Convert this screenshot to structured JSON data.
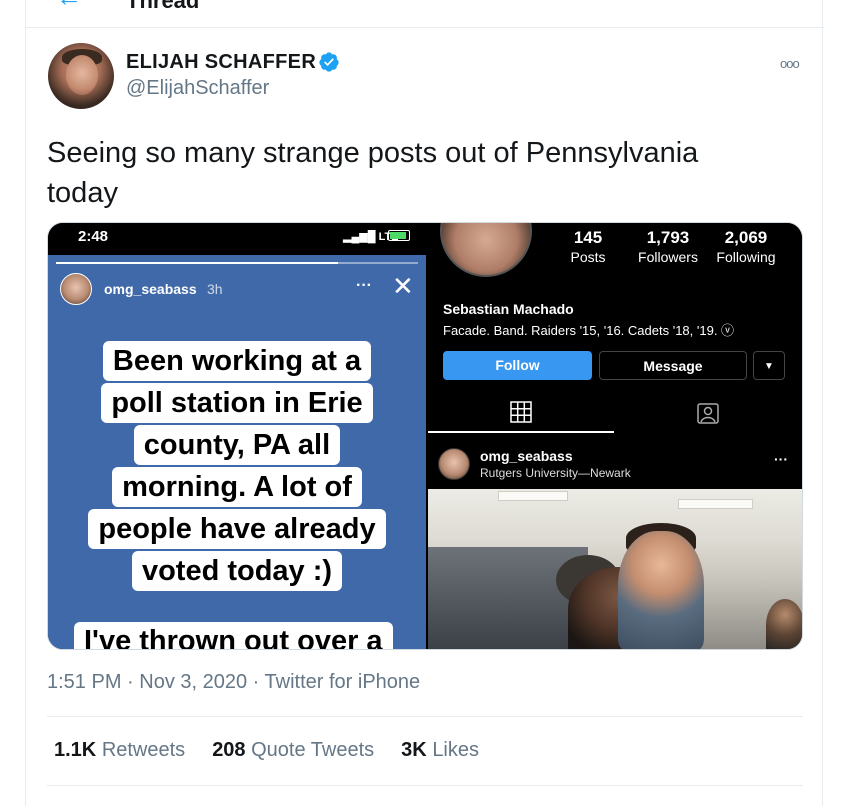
{
  "header": {
    "title": "Thread"
  },
  "author": {
    "display_name": "ELIJAH SCHAFFER",
    "handle": "@ElijahSchaffer",
    "verified": true,
    "verified_color": "#1da1f2"
  },
  "tweet": {
    "text_line1": "Seeing so many strange posts out of Pennsylvania",
    "text_line2": "today",
    "timestamp": "1:51 PM · Nov 3, 2020 · Twitter for iPhone"
  },
  "stats": {
    "retweets_count": "1.1K",
    "retweets_label": "Retweets",
    "quotes_count": "208",
    "quotes_label": "Quote Tweets",
    "likes_count": "3K",
    "likes_label": "Likes"
  },
  "media": {
    "story": {
      "status_time": "2:48",
      "network": "LTE",
      "progress": 0.78,
      "username": "omg_seabass",
      "age": "3h",
      "lines": [
        "Been working at a",
        "poll station in Erie",
        "county, PA all",
        "morning. A lot of",
        "people have already",
        "voted today :)"
      ],
      "cut_line": "I've thrown out over a"
    },
    "profile": {
      "posts_count": "145",
      "posts_label": "Posts",
      "followers_count": "1,793",
      "followers_label": "Followers",
      "following_count": "2,069",
      "following_label": "Following",
      "name": "Sebastian Machado",
      "bio": "Facade. Band. Raiders '15, '16. Cadets '18, '19. ⓥ",
      "follow_label": "Follow",
      "message_label": "Message"
    },
    "post": {
      "username": "omg_seabass",
      "location": "Rutgers University—Newark"
    }
  },
  "icons": [
    "back-arrow-icon",
    "verified-badge-icon",
    "more-options-icon",
    "signal-icon",
    "battery-icon",
    "close-icon",
    "grid-icon",
    "tagged-icon",
    "chevron-down-icon"
  ]
}
